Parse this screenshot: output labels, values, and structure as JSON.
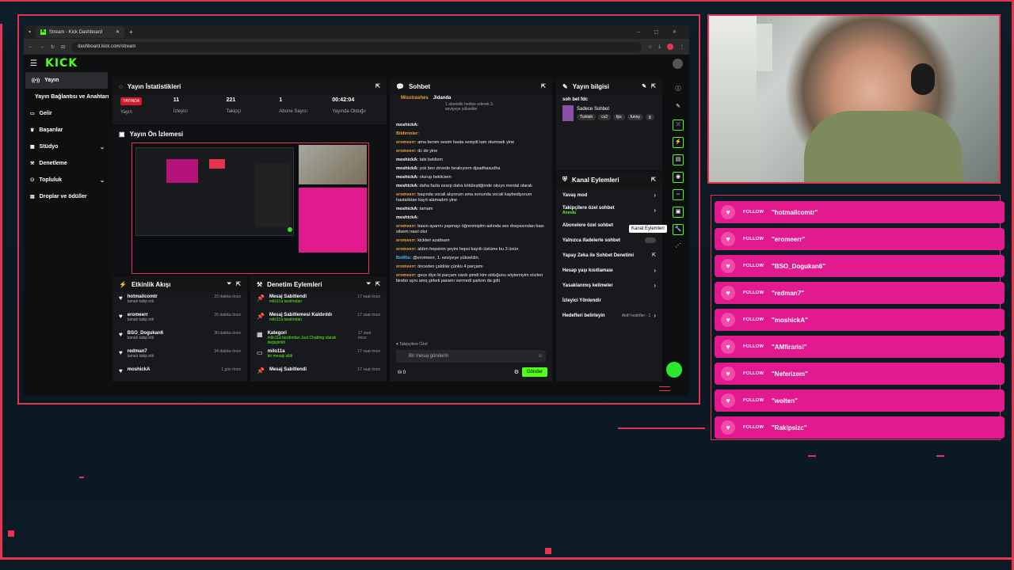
{
  "browser": {
    "tab_title": "Stream - Kick Dashboard",
    "url": "dashboard.kick.com/stream"
  },
  "brand": {
    "logo": "KICK",
    "accent": "#53fc18",
    "overlay_red": "#e8334f",
    "follow_pink": "#e31a8f"
  },
  "sidebar": {
    "items": [
      {
        "label": "Yayın",
        "icon": "broadcast-icon"
      },
      {
        "label": "Yayın Bağlantısı ve Anahtarı",
        "icon": ""
      },
      {
        "label": "Gelir",
        "icon": "money-icon"
      },
      {
        "label": "Başarılar",
        "icon": "trophy-icon"
      },
      {
        "label": "Stüdyo",
        "icon": "studio-icon"
      },
      {
        "label": "Denetleme",
        "icon": "wrench-icon"
      },
      {
        "label": "Topluluk",
        "icon": "people-icon"
      },
      {
        "label": "Droplar ve ödüller",
        "icon": "gift-icon"
      }
    ]
  },
  "stats": {
    "title": "Yayın İstatistikleri",
    "live_badge": "YAYINDA",
    "items": [
      {
        "value": "",
        "label": "Yayın"
      },
      {
        "value": "11",
        "label": "İzleyici"
      },
      {
        "value": "221",
        "label": "Takipçi"
      },
      {
        "value": "1",
        "label": "Abone Sayısı"
      },
      {
        "value": "00:42:04",
        "label": "Yayında Olduğu"
      }
    ]
  },
  "preview": {
    "title": "Yayın Ön İzlemesi"
  },
  "activity": {
    "title": "Etkinlik Akışı",
    "items": [
      {
        "name": "hotmailcomtr",
        "sub": "kanalı takip etti",
        "time": "23 dakika önce"
      },
      {
        "name": "eromeerr",
        "sub": "kanalı takip etti",
        "time": "26 dakika önce"
      },
      {
        "name": "BSO_Dogukan6",
        "sub": "kanalı takip etti",
        "time": "30 dakika önce"
      },
      {
        "name": "redman7",
        "sub": "kanalı takip etti",
        "time": "34 dakika önce"
      },
      {
        "name": "moshickA",
        "sub": "",
        "time": "1 gün önce"
      }
    ]
  },
  "modactions": {
    "title": "Denetim Eylemleri",
    "items": [
      {
        "name": "Mesaj Sabitlendi",
        "sub": "milo11a tarafından",
        "time": "17 saat önce"
      },
      {
        "name": "Mesaj Sabitlemesi Kaldırıldı",
        "sub": "milo11a tarafından",
        "time": "17 saat önce"
      },
      {
        "name": "Kategori",
        "sub": "milo11a tarafından Just Chatting olarak değiştirildi",
        "time": "17 saat önce"
      },
      {
        "name": "milo11a",
        "sub": "bir mesajı sildi",
        "time": "17 saat önce"
      },
      {
        "name": "Mesaj Sabitlendi",
        "sub": "",
        "time": "17 saat önce"
      }
    ]
  },
  "chat": {
    "title": "Sohbet",
    "pinned_user": "Misstrashes",
    "pinned_user2": "Jidanda",
    "pinned_text": "1 abonelik hediye ederek 3. seviyeye yükseltin",
    "input_placeholder": "Bir mesaj gönderin",
    "send_label": "Gönder",
    "count": "0",
    "followers_only": "Takipçilere Özel",
    "messages": [
      {
        "user": "moshickA:",
        "text": ""
      },
      {
        "user": "Bildirimler:",
        "text": ""
      },
      {
        "user": "eromeerr:",
        "text": "ama benim sesim hasta sesiydi tam oturmadı yine"
      },
      {
        "user": "eromeerr:",
        "text": "dc de yine"
      },
      {
        "user": "moshickA:",
        "text": "tabi bekliem"
      },
      {
        "user": "moshickA:",
        "text": "yok ben zirvede bırakıyorm djsadhasudha"
      },
      {
        "user": "moshickA:",
        "text": "oturup bekliciem"
      },
      {
        "user": "moshickA:",
        "text": "daha fazla ısrarp daha kötüleştiğimde okuyo mental olarak"
      },
      {
        "user": "eromeerr:",
        "text": "başında vocali alıyorum ama sonunda vocali kaybediyorum hastalıktan kayıt alamadım yine"
      },
      {
        "user": "moshickA:",
        "text": "tamam"
      },
      {
        "user": "moshickA:",
        "text": ""
      },
      {
        "user": "eromeerr:",
        "text": "basın ayarını yapmayı öğrenmiştim aslında ses dosyasından bası silsem nasıl olur"
      },
      {
        "user": "eromeerr:",
        "text": "kickleri azaltsam"
      },
      {
        "user": "eromeerr:",
        "text": "aldım hepsinin şeyini hepsi kayıtlı üstüme bu 3 ünün"
      },
      {
        "user": "BotRix:",
        "text": "@eromeerr, 1. seviyeye yükseldin."
      },
      {
        "user": "eromeerr:",
        "text": "önceden çaldılar çünkü 4 parçamı"
      },
      {
        "user": "eromeerr:",
        "text": "gece diye bi parçam vardı şimdi kim olduğunu söylemiyim sözleri birebir aynı amq şirketi paramı vermedi şarkım da gitti"
      }
    ]
  },
  "streaminfo": {
    "title": "Yayın bilgisi",
    "stream_title": "soh bet fdc",
    "category": "Sadece Sohbet",
    "tags": [
      "Turkish",
      "cs2",
      "fps",
      "funny",
      "g"
    ]
  },
  "channel_actions": {
    "title": "Kanal Eylemleri",
    "items": [
      {
        "label": "Yavaş mod",
        "extra": "",
        "type": "chev"
      },
      {
        "label": "Takipçilere özel sohbet",
        "extra": "Anında",
        "type": "chev"
      },
      {
        "label": "Abonelere özel sohbet",
        "extra": "",
        "type": "none"
      },
      {
        "label": "Yalnızca ifadelerle sohbet",
        "extra": "",
        "type": "toggle"
      },
      {
        "label": "Yapay Zeka ile Sohbet Denetimi",
        "extra": "",
        "type": "ext"
      },
      {
        "label": "Hesap yaşı kısıtlaması",
        "extra": "",
        "type": "chev"
      },
      {
        "label": "Yasaklanmış kelimeler",
        "extra": "",
        "type": "chev"
      },
      {
        "label": "İzleyici Yönlendir",
        "extra": "",
        "type": "none"
      },
      {
        "label": "Hedefleri belirleyin",
        "extra": "Aktif hedefler - 1",
        "type": "chev"
      }
    ]
  },
  "tooltip": "Kanal Eylemleri",
  "follow_alerts": {
    "label": "FOLLOW",
    "names": [
      "\"hotmailcomtr\"",
      "\"eromeerr\"",
      "\"BSO_Dogukan6\"",
      "\"redman7\"",
      "\"moshickA\"",
      "\"AMfirarisi\"",
      "\"Neferizem\"",
      "\"wolten\"",
      "\"Rakipsizc\""
    ]
  }
}
